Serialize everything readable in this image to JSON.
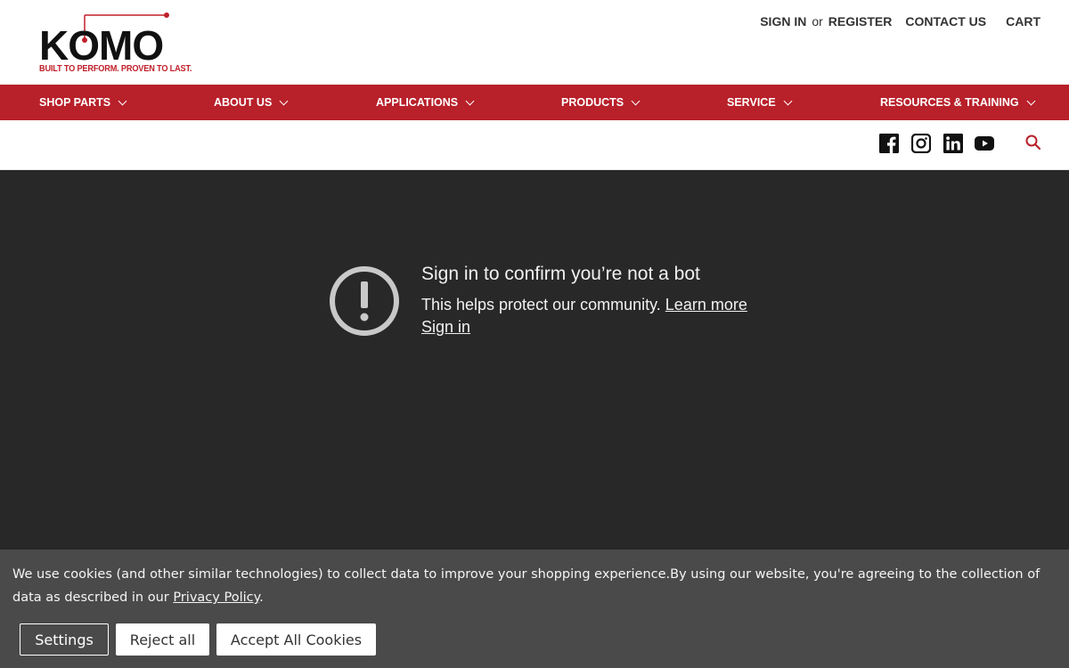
{
  "brand": {
    "logo_text": "KOMO",
    "tagline": "BUILT TO PERFORM. PROVEN TO LAST.",
    "accent_color": "#b8202a"
  },
  "top_links": {
    "sign_in": "SIGN IN",
    "or": "or",
    "register": "REGISTER",
    "contact": "CONTACT US",
    "cart": "CART"
  },
  "nav": {
    "items": [
      {
        "label": "SHOP PARTS"
      },
      {
        "label": "ABOUT US"
      },
      {
        "label": "APPLICATIONS"
      },
      {
        "label": "PRODUCTS"
      },
      {
        "label": "SERVICE"
      },
      {
        "label": "RESOURCES & TRAINING"
      }
    ]
  },
  "social": {
    "icons": [
      "facebook-icon",
      "instagram-icon",
      "linkedin-icon",
      "youtube-icon",
      "search-icon"
    ]
  },
  "embed": {
    "title": "Sign in to confirm you’re not a bot",
    "subtitle": "This helps protect our community.",
    "learn_more": "Learn more",
    "sign_in": "Sign in",
    "icon": "warning-icon"
  },
  "cookie": {
    "text": "We use cookies (and other similar technologies) to collect data to improve your shopping experience.By using our website, you're agreeing to the collection of data as described in our",
    "link": "Privacy Policy",
    "after_link": ".",
    "settings": "Settings",
    "reject": "Reject all",
    "accept": "Accept All Cookies"
  }
}
